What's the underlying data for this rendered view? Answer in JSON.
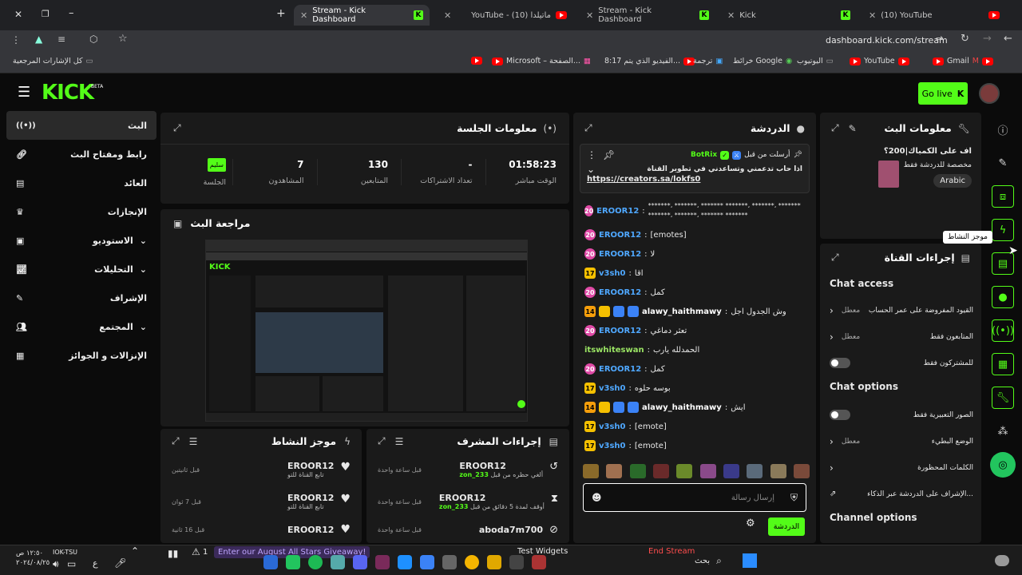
{
  "browser": {
    "tabs": [
      {
        "title": "Stream - Kick Dashboard",
        "icon": "kick-icon",
        "active": true
      },
      {
        "title": "YouTube - (10) ماتيلدا",
        "icon": "youtube-icon"
      },
      {
        "title": "Stream - Kick Dashboard",
        "icon": "kick-icon"
      },
      {
        "title": "Kick",
        "icon": "kick-icon"
      },
      {
        "title": "(10) YouTube",
        "icon": "youtube-icon"
      }
    ],
    "url": "dashboard.kick.com/stream",
    "bookmarks": [
      "كل الإشارات المرجعية",
      "Microsoft – الصفحة...",
      "8:17 الفيديو الذي يتم...",
      "ترجمة",
      "خرائط Google",
      "اليوتيوب",
      "YouTube",
      "Gmail"
    ]
  },
  "header": {
    "logo": "KICK",
    "beta": "BETA",
    "go_live": "Go live"
  },
  "sidebar": {
    "items": [
      {
        "label": "البث",
        "icon": "live-icon"
      },
      {
        "label": "رابط ومفتاح البث",
        "icon": "link-icon"
      },
      {
        "label": "العائد",
        "icon": "revenue-icon"
      },
      {
        "label": "الإنجازات",
        "icon": "trophy-icon"
      },
      {
        "label": "الاستوديو",
        "icon": "studio-icon"
      },
      {
        "label": "التحليلات",
        "icon": "analytics-icon"
      },
      {
        "label": "الإشراف",
        "icon": "moderation-icon"
      },
      {
        "label": "المجتمع",
        "icon": "community-icon"
      },
      {
        "label": "الإنزالات و الجوائز",
        "icon": "drops-icon"
      }
    ]
  },
  "session": {
    "title": "معلومات الجلسة",
    "stats": [
      {
        "value": "01:58:23",
        "label": "الوقت مباشر"
      },
      {
        "value": "-",
        "label": "تعداد الاشتراكات"
      },
      {
        "value": "130",
        "label": "المتابعين"
      },
      {
        "value": "7",
        "label": "المشاهدون"
      },
      {
        "value": "سليم",
        "label": "الجلسة"
      }
    ]
  },
  "preview": {
    "title": "مراجعة البث"
  },
  "activity": {
    "title": "موجز النشاط",
    "items": [
      {
        "user": "EROOR12",
        "action": "تابع القناة للتو",
        "time": "قبل ثانيتين"
      },
      {
        "user": "EROOR12",
        "action": "تابع القناة للتو",
        "time": "قبل 7 ثوان"
      },
      {
        "user": "EROOR12",
        "action": "",
        "time": "قبل 16 ثانية"
      }
    ]
  },
  "mod_actions": {
    "title": "إجراءات المشرف",
    "items": [
      {
        "user": "EROOR12",
        "by": "zon_233",
        "action": "ألغي حظره من قبل",
        "time": "قبل ساعة واحدة"
      },
      {
        "user": "EROOR12",
        "by": "zon_233",
        "action": "أوقف لمدة 5 دقائق من قبل",
        "time": "قبل ساعة واحدة"
      },
      {
        "user": "aboda7m700",
        "by": "",
        "action": "",
        "time": "قبل ساعة واحدة"
      }
    ]
  },
  "chat": {
    "title": "الدردشة",
    "pinned_by": "أرسلت من قبل",
    "pinned_user": "BotRix",
    "pinned_text": "اذا حاب تدعمني وتساعدني في تطوير القناة",
    "pinned_link": "https://creators.sa/lokfs0",
    "messages": [
      {
        "badge": "20",
        "user": "EROOR12",
        "color": "#4fa8ff",
        "text": "*******، *******، ******* *******، *******، ******* *******، *******، ******* *******"
      },
      {
        "badge": "20",
        "user": "EROOR12",
        "color": "#4fa8ff",
        "text": "[emotes]"
      },
      {
        "badge": "20",
        "user": "EROOR12",
        "color": "#4fa8ff",
        "text": "لا"
      },
      {
        "badge": "17",
        "user": "v3sh0",
        "color": "#4fa8ff",
        "text": "اقا"
      },
      {
        "badge": "20",
        "user": "EROOR12",
        "color": "#4fa8ff",
        "text": "كمل"
      },
      {
        "badge": "14",
        "user": "alawy_haithmawy",
        "color": "#ffffff",
        "text": "وش الجدول اجل"
      },
      {
        "badge": "20",
        "user": "EROOR12",
        "color": "#4fa8ff",
        "text": "تعثر دماغي"
      },
      {
        "badge": "",
        "user": "itswhiteswan",
        "color": "#9be564",
        "text": "الحمدلله يارب"
      },
      {
        "badge": "20",
        "user": "EROOR12",
        "color": "#4fa8ff",
        "text": "كمل"
      },
      {
        "badge": "17",
        "user": "v3sh0",
        "color": "#4fa8ff",
        "text": "بوسه حلوه"
      },
      {
        "badge": "14",
        "user": "alawy_haithmawy",
        "color": "#ffffff",
        "text": "ايش"
      },
      {
        "badge": "17",
        "user": "v3sh0",
        "color": "#4fa8ff",
        "text": "[emote]"
      },
      {
        "badge": "17",
        "user": "v3sh0",
        "color": "#4fa8ff",
        "text": "[emote]"
      }
    ],
    "placeholder": "إرسال رسالة",
    "send": "الدردشة"
  },
  "stream_info": {
    "title": "معلومات البث",
    "stream_title": "اف على الكمباك|200؟",
    "category": "مخصصة للدردشة فقط",
    "language": "Arabic"
  },
  "channel_actions": {
    "title": "إجراءات القناة",
    "chat_access_heading": "Chat access",
    "chat_access": [
      {
        "label": "القيود المفروضة على عمر الحساب",
        "value": "معطل",
        "type": "chevron"
      },
      {
        "label": "المتابعون فقط",
        "value": "معطل",
        "type": "chevron"
      },
      {
        "label": "للمشتركون فقط",
        "value": "",
        "type": "toggle"
      }
    ],
    "chat_options_heading": "Chat options",
    "chat_options": [
      {
        "label": "الصور التعبيرية فقط",
        "value": "",
        "type": "toggle"
      },
      {
        "label": "الوضع البطيء",
        "value": "معطل",
        "type": "chevron"
      },
      {
        "label": "الكلمات المحظورة",
        "value": "",
        "type": "chevron"
      },
      {
        "label": "الإشراف على الدردشة عبر الذكاء...",
        "value": "",
        "type": "external"
      }
    ],
    "channel_options_heading": "Channel options"
  },
  "right_rail": {
    "tooltip": "موجز النشاط"
  },
  "taskbar": {
    "giveaway": "Enter our August All Stars Giveaway!",
    "test_widgets": "Test Widgets",
    "end_stream": "End Stream",
    "search": "بحث",
    "time": "١٢:٥٠ ص",
    "date": "٢٠٢٤/٠٨/٢٥",
    "ticker": "IOK-TSU",
    "alert_count": "1"
  },
  "colors": {
    "kick_green": "#53fc18",
    "panel": "#1a1a1a",
    "bg": "#0b0b0b"
  }
}
